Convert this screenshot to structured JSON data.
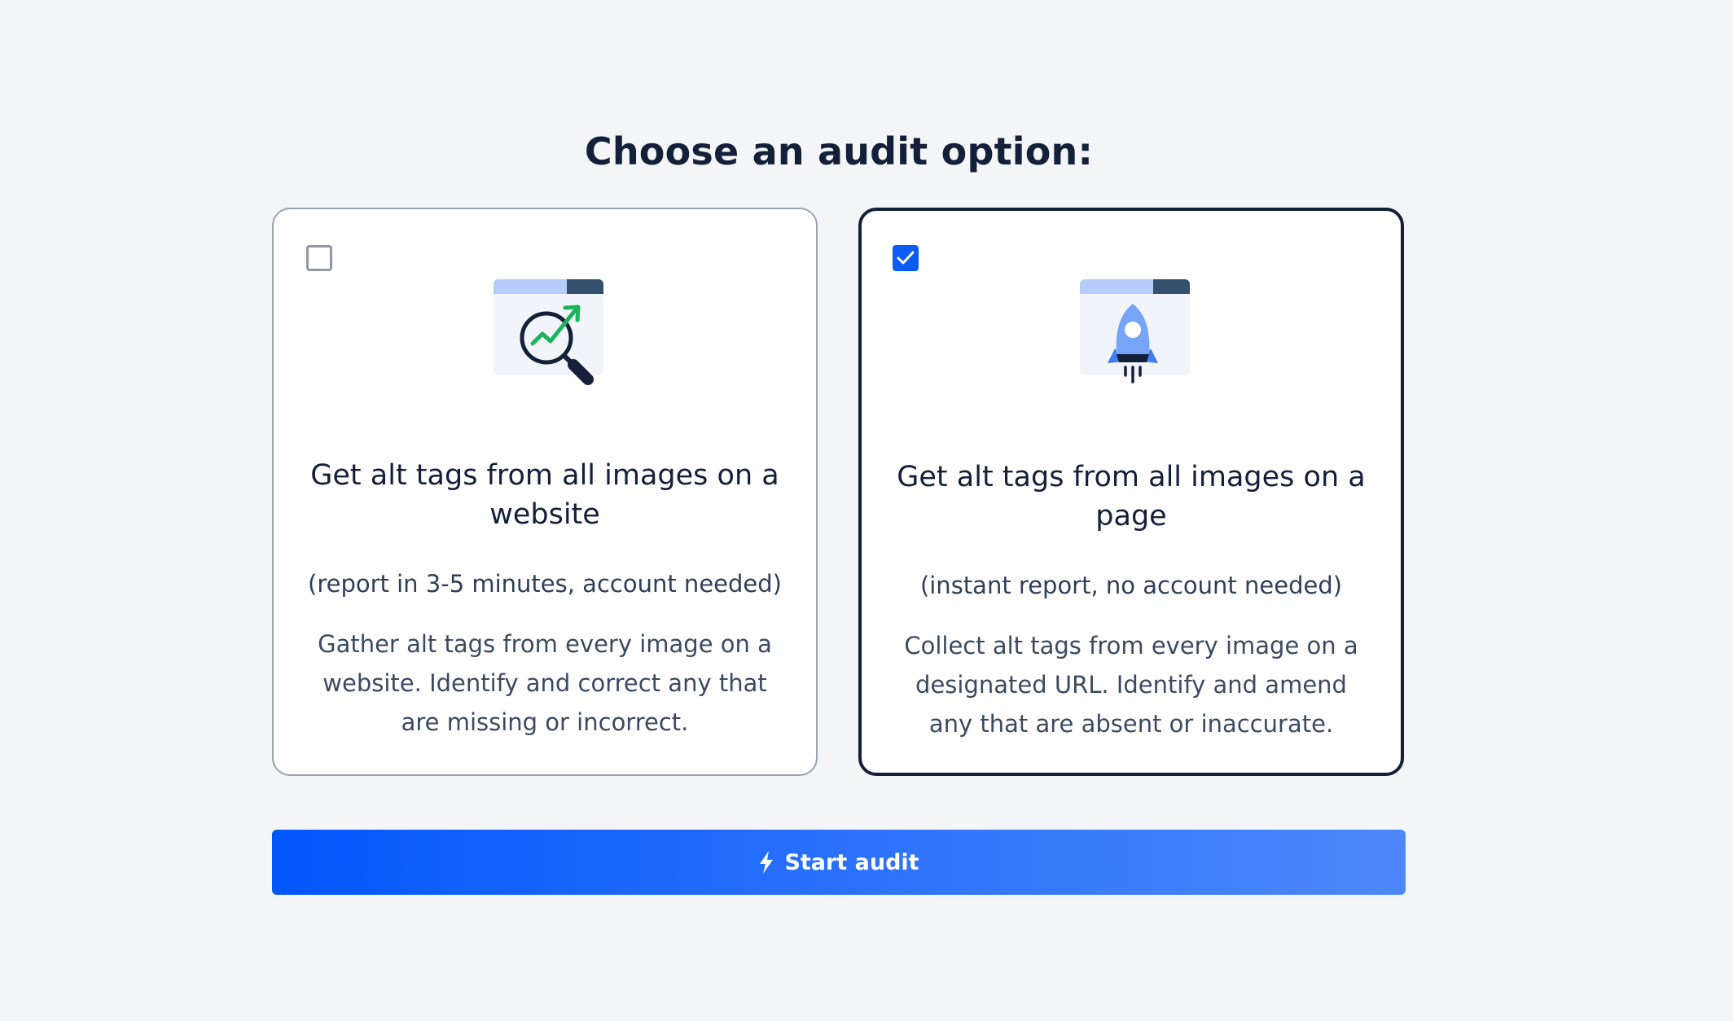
{
  "page": {
    "title": "Choose an audit option:"
  },
  "options": [
    {
      "id": "website",
      "checked": false,
      "icon": "magnifier-chart-icon",
      "title": "Get alt tags from all images on a website",
      "subtitle": "(report in 3-5 minutes, account needed)",
      "description": "Gather alt tags from every image on a website. Identify and correct any that are missing or incorrect."
    },
    {
      "id": "page",
      "checked": true,
      "icon": "rocket-icon",
      "title": "Get alt tags from all images on a page",
      "subtitle": "(instant report, no account needed)",
      "description": "Collect alt tags from every image on a designated URL. Identify and amend any that are absent or inaccurate."
    }
  ],
  "actions": {
    "start_label": "Start audit",
    "start_icon": "lightning-bolt-icon"
  },
  "colors": {
    "background": "#f3f5f7",
    "text_dark": "#14203a",
    "accent_blue": "#0b5cf5",
    "chart_green": "#19b55a"
  }
}
